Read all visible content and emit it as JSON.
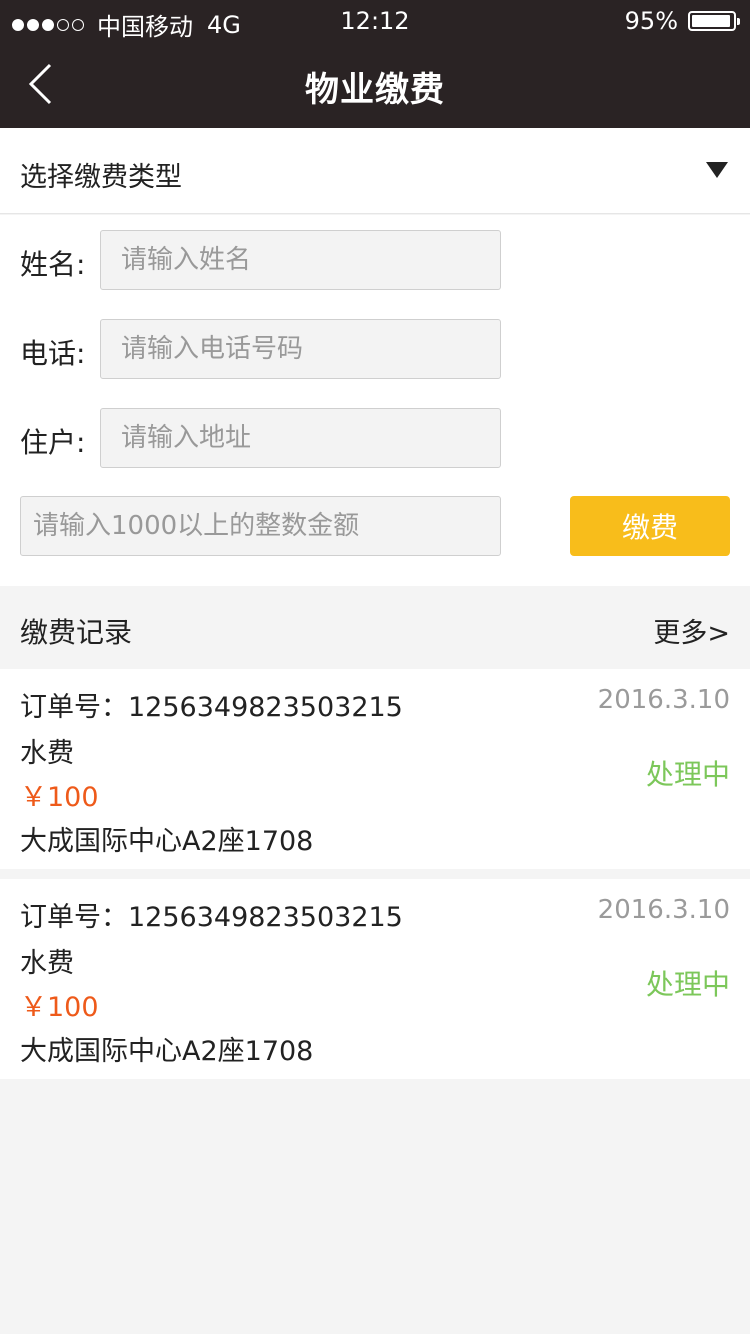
{
  "status_bar": {
    "carrier": "中国移动",
    "network": "4G",
    "time": "12:12",
    "battery": "95%",
    "battery_level": 0.95
  },
  "nav": {
    "title": "物业缴费",
    "back_icon": "chevron-left-icon"
  },
  "type_select": {
    "label": "选择缴费类型",
    "icon": "caret-down-icon"
  },
  "form": {
    "name_label": "姓名:",
    "name_placeholder": "请输入姓名",
    "phone_label": "电话:",
    "phone_placeholder": "请输入电话号码",
    "address_label": "住户:",
    "address_placeholder": "请输入地址",
    "amount_placeholder": "请输入1000以上的整数金额",
    "pay_button": "缴费"
  },
  "records": {
    "title": "缴费记录",
    "more": "更多>",
    "items": [
      {
        "order": "订单号：1256349823503215",
        "date": "2016.3.10",
        "type": "水费",
        "amount": "￥100",
        "status": "处理中",
        "address": "大成国际中心A2座1708"
      },
      {
        "order": "订单号：1256349823503215",
        "date": "2016.3.10",
        "type": "水费",
        "amount": "￥100",
        "status": "处理中",
        "address": "大成国际中心A2座1708"
      }
    ]
  },
  "colors": {
    "header_bg": "#2a2324",
    "accent": "#f8bd1b",
    "amount": "#ee5a1a",
    "status": "#7cc75a"
  }
}
